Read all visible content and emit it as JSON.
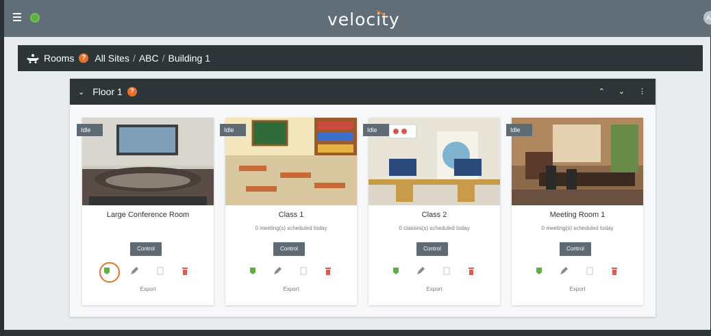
{
  "app": {
    "logo": "velocity",
    "avatar": "AA"
  },
  "breadcrumb": {
    "section": "Rooms",
    "items": [
      "All Sites",
      "ABC",
      "Building 1"
    ]
  },
  "floor": {
    "title": "Floor 1"
  },
  "rooms": [
    {
      "status": "Idle",
      "name": "Large Conference Room",
      "subtitle": "",
      "control": "Control",
      "export": "Export"
    },
    {
      "status": "Idle",
      "name": "Class 1",
      "subtitle": "0 meeting(s) scheduled today",
      "control": "Control",
      "export": "Export"
    },
    {
      "status": "Idle",
      "name": "Class 2",
      "subtitle": "0 classes(s) scheduled today",
      "control": "Control",
      "export": "Export"
    },
    {
      "status": "Idle",
      "name": "Meeting Room 1",
      "subtitle": "0 meeting(s) scheduled today",
      "control": "Control",
      "export": "Export"
    }
  ],
  "colors": {
    "accent": "#e8702a",
    "green": "#5cb043",
    "red": "#e05a4e",
    "header": "#616e77",
    "dark": "#2d3538"
  }
}
